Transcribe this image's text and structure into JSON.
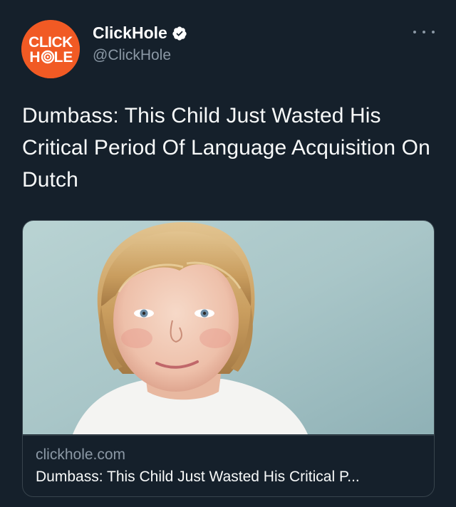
{
  "account": {
    "display_name": "ClickHole",
    "handle": "@ClickHole",
    "avatar_text_top": "CLICK",
    "avatar_text_bottom_left": "H",
    "avatar_text_bottom_right": "LE",
    "verified": true
  },
  "tweet": {
    "text": "Dumbass: This Child Just Wasted His Critical Period Of Language Acquisition On Dutch"
  },
  "card": {
    "domain": "clickhole.com",
    "title": "Dumbass: This Child Just Wasted His Critical P..."
  },
  "icons": {
    "more": "more-icon",
    "verified": "verified-badge-icon"
  },
  "colors": {
    "background": "#15202b",
    "brand_orange": "#f15a24",
    "verified_fill": "#ffffff",
    "secondary_text": "#8b98a5"
  }
}
